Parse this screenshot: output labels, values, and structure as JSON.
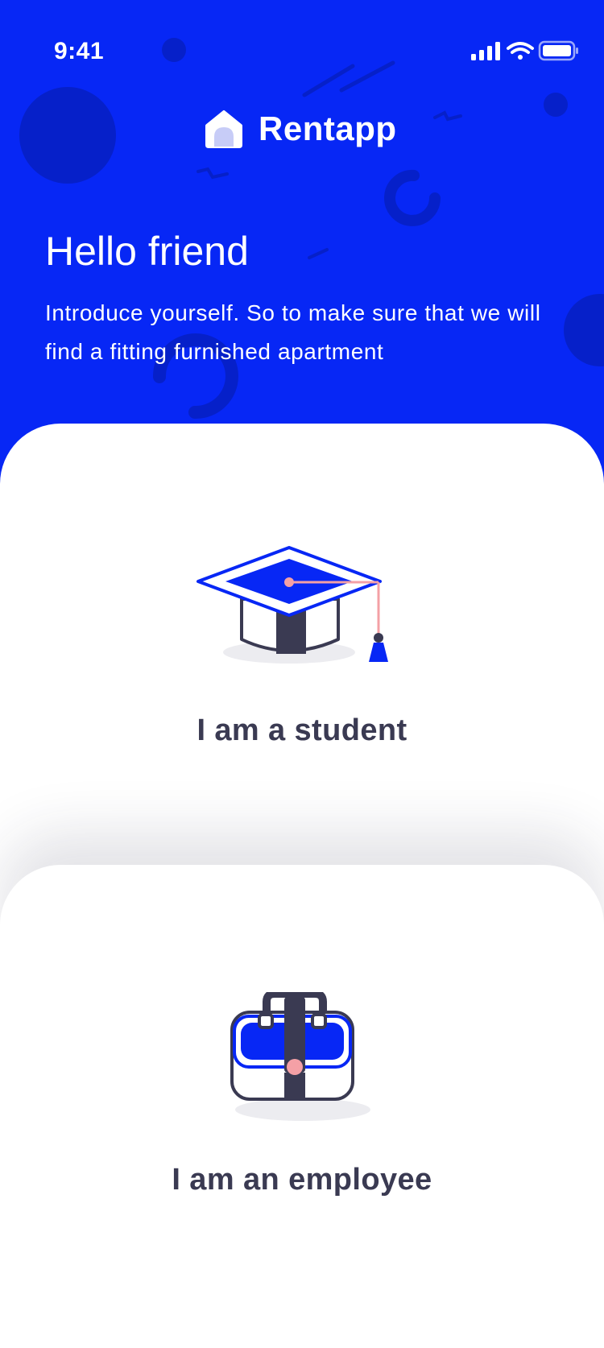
{
  "status_bar": {
    "time": "9:41"
  },
  "brand": {
    "name": "Rentapp",
    "icon": "house-icon"
  },
  "header": {
    "greeting": "Hello friend",
    "intro": "Introduce yourself. So to make sure that we will find a fitting furnished apartment"
  },
  "options": [
    {
      "label": "I am a student",
      "icon": "graduation-cap-icon"
    },
    {
      "label": "I am an employee",
      "icon": "briefcase-icon"
    }
  ],
  "colors": {
    "primary_blue": "#0727f5",
    "dark_ink": "#3a3a52",
    "accent_pink": "#f4a0a6",
    "card_background": "#ffffff"
  }
}
